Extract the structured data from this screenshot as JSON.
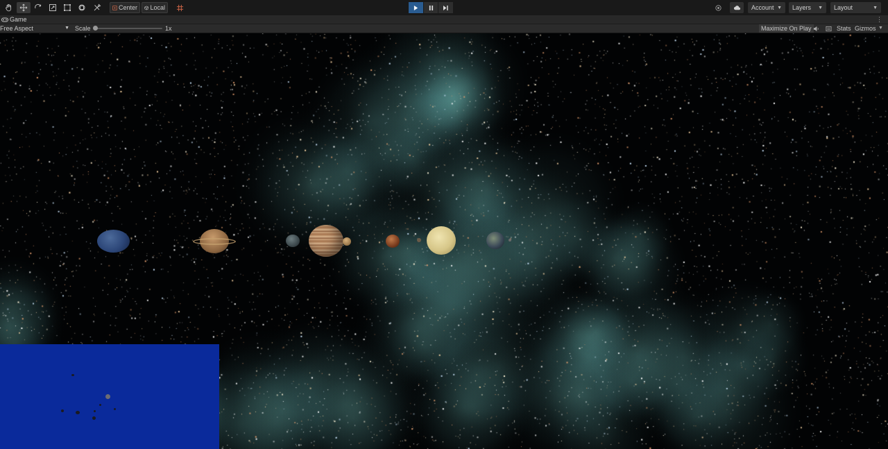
{
  "toolbar": {
    "tools": [
      {
        "name": "hand-tool",
        "active": false
      },
      {
        "name": "move-tool",
        "active": true
      },
      {
        "name": "rotate-tool",
        "active": false
      },
      {
        "name": "scale-tool",
        "active": false
      },
      {
        "name": "rect-tool",
        "active": false
      },
      {
        "name": "transform-tool",
        "active": false
      },
      {
        "name": "custom-tool",
        "active": false
      }
    ],
    "pivot_mode": "Center",
    "pivot_rotation": "Local",
    "account_label": "Account",
    "layers_label": "Layers",
    "layout_label": "Layout"
  },
  "playmode": {
    "play_active": true
  },
  "tab": {
    "title": "Game"
  },
  "gamebar": {
    "aspect": "Free Aspect",
    "scale_label": "Scale",
    "scale_value": "1x",
    "maximize_label": "Maximize On Play",
    "stats_label": "Stats",
    "gizmos_label": "Gizmos"
  },
  "scene": {
    "background_color": "#020304",
    "nebula_color": "#5a8a84",
    "minimap_color": "#0a2a9b",
    "planets": [
      "neptune",
      "saturn",
      "uranus-like",
      "jupiter",
      "mars",
      "venus",
      "earth"
    ]
  }
}
